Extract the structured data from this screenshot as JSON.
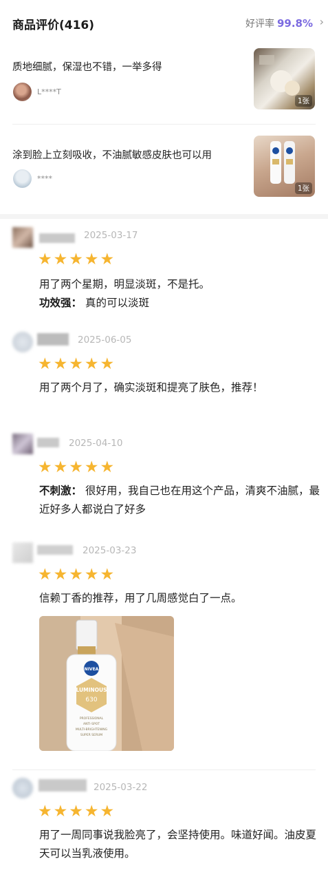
{
  "header": {
    "title": "商品评价(416)",
    "rating_label": "好评率",
    "rating_value": "99.8%"
  },
  "featured": [
    {
      "text": "质地细腻，保湿也不错，一举多得",
      "user": "L****T",
      "image_count": "1张",
      "icon": "photo-thumbnail"
    },
    {
      "text": "涂到脸上立刻吸收，不油腻敏感皮肤也可以用",
      "user": "****",
      "image_count": "1张",
      "icon": "photo-thumbnail"
    }
  ],
  "reviews": [
    {
      "date": "2025-03-17",
      "stars": "★★★★★",
      "rating": 5,
      "line1": "用了两个星期，明显淡斑，不是托。",
      "tag": "功效强：",
      "tag_text": " 真的可以淡斑"
    },
    {
      "date": "2025-06-05",
      "stars": "★★★★★",
      "rating": 5,
      "line1": "用了两个月了，确实淡斑和提亮了肤色，推荐！"
    },
    {
      "date": "2025-04-10",
      "stars": "★★★★★",
      "rating": 5,
      "tag": "不刺激：",
      "tag_text": " 很好用，我自己也在用这个产品，清爽不油腻，最近好多人都说白了好多"
    },
    {
      "date": "2025-03-23",
      "stars": "★★★★★",
      "rating": 5,
      "line1": "信赖丁香的推荐，用了几周感觉白了一点。",
      "image": {
        "brand": "NIVEA",
        "product": "LUMINOUS",
        "code": "630",
        "line_a": "PROFESSIONAL",
        "line_b": "ANTI-SPOT",
        "line_c": "MULTI-BRIGHTENING",
        "line_d": "SUPER SERUM"
      }
    },
    {
      "date": "2025-03-22",
      "stars": "★★★★★",
      "rating": 5,
      "line1": "用了一周同事说我脸亮了，会坚持使用。味道好闻。油皮夏天可以当乳液使用。"
    }
  ],
  "colors": {
    "accent": "#7b6ae0",
    "star": "#f6b530"
  }
}
